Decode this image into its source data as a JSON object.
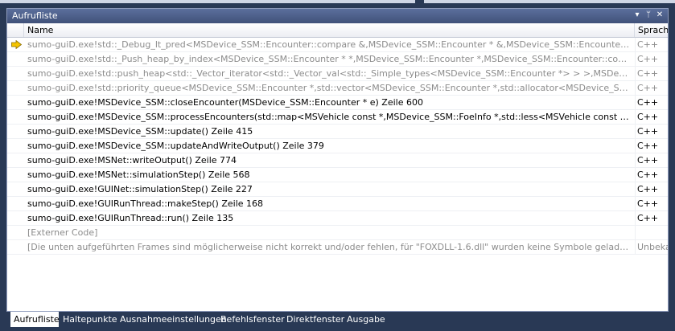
{
  "panel": {
    "title": "Aufrufliste",
    "controls": {
      "dropdown": "▾",
      "pin": "ᛘ",
      "close": "✕"
    }
  },
  "columns": {
    "name": "Name",
    "language": "Sprache"
  },
  "rows": [
    {
      "name": "sumo-guiD.exe!std::_Debug_lt_pred<MSDevice_SSM::Encounter::compare &,MSDevice_SSM::Encounter * &,MSDevice_SSM::Encounter * &>(MSDevice_SSM::Encounter::compare & _Pred, MSDevice_SSM::Encounter * & _Left)",
      "language": "C++",
      "dim": true,
      "current": true
    },
    {
      "name": "sumo-guiD.exe!std::_Push_heap_by_index<MSDevice_SSM::Encounter * *,MSDevice_SSM::Encounter *,MSDevice_SSM::Encounter::compare>(MSDevice_SSM::Encounter * * _First)",
      "language": "C++",
      "dim": true
    },
    {
      "name": "sumo-guiD.exe!std::push_heap<std::_Vector_iterator<std::_Vector_val<std::_Simple_types<MSDevice_SSM::Encounter *> > >,MSDevice_SSM::Encounter::compare>(std::_Vector_iterator)",
      "language": "C++",
      "dim": true
    },
    {
      "name": "sumo-guiD.exe!std::priority_queue<MSDevice_SSM::Encounter *,std::vector<MSDevice_SSM::Encounter *,std::allocator<MSDevice_SSM::Encounter *> >,MSDevice_SSM::Encounter::compare>::push(MSDevice_SSM::Encounter * const & _Val)",
      "language": "C++",
      "dim": true
    },
    {
      "name": "sumo-guiD.exe!MSDevice_SSM::closeEncounter(MSDevice_SSM::Encounter * e) Zeile 600",
      "language": "C++",
      "dim": false
    },
    {
      "name": "sumo-guiD.exe!MSDevice_SSM::processEncounters(std::map<MSVehicle const *,MSDevice_SSM::FoeInfo *,std::less<MSVehicle const *>,std::allocator<std::pair<MSVehicle const * const,MSDevice_SSM::FoeInfo *> > > & foes, bool forceClose)",
      "language": "C++",
      "dim": false
    },
    {
      "name": "sumo-guiD.exe!MSDevice_SSM::update() Zeile 415",
      "language": "C++",
      "dim": false
    },
    {
      "name": "sumo-guiD.exe!MSDevice_SSM::updateAndWriteOutput() Zeile 379",
      "language": "C++",
      "dim": false
    },
    {
      "name": "sumo-guiD.exe!MSNet::writeOutput() Zeile 774",
      "language": "C++",
      "dim": false
    },
    {
      "name": "sumo-guiD.exe!MSNet::simulationStep() Zeile 568",
      "language": "C++",
      "dim": false
    },
    {
      "name": "sumo-guiD.exe!GUINet::simulationStep() Zeile 227",
      "language": "C++",
      "dim": false
    },
    {
      "name": "sumo-guiD.exe!GUIRunThread::makeStep() Zeile 168",
      "language": "C++",
      "dim": false
    },
    {
      "name": "sumo-guiD.exe!GUIRunThread::run() Zeile 135",
      "language": "C++",
      "dim": false
    },
    {
      "name": "[Externer Code]",
      "language": "",
      "dim": true
    },
    {
      "name": "[Die unten aufgeführten Frames sind möglicherweise nicht korrekt und/oder fehlen, für \"FOXDLL-1.6.dll\" wurden keine Symbole geladen.]",
      "language": "Unbekannt",
      "dim": true
    }
  ],
  "tabs": [
    {
      "label": "Aufrufliste",
      "active": true
    },
    {
      "label": "Haltepunkte",
      "active": false
    },
    {
      "label": "Ausnahmeeinstellungen",
      "active": false
    },
    {
      "label": "Befehlsfenster",
      "active": false
    },
    {
      "label": "Direktfenster",
      "active": false
    },
    {
      "label": "Ausgabe",
      "active": false
    }
  ],
  "colors": {
    "chrome": "#293955",
    "titlebar": "#4d6090",
    "current_frame_arrow": "#f5c400",
    "dim_text": "#8c8c8c"
  }
}
